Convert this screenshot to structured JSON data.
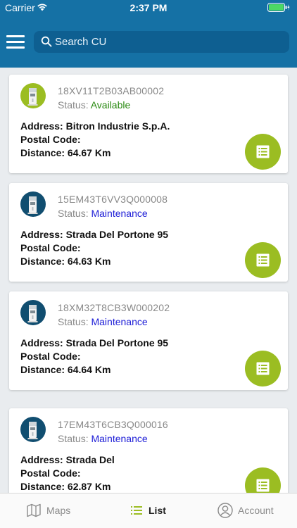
{
  "status_bar": {
    "carrier": "Carrier",
    "time": "2:37 PM"
  },
  "search": {
    "placeholder": "Search CU",
    "value": ""
  },
  "labels": {
    "status": "Status:",
    "address": "Address:",
    "postal_code": "Postal Code:",
    "distance": "Distance:"
  },
  "colors": {
    "header": "#1571a5",
    "available": "#2a8a12",
    "maintenance": "#1b1bd6",
    "fab": "#9bbd22"
  },
  "units": [
    {
      "id": "18XV11T2B03AB00002",
      "status": "Available",
      "status_kind": "available",
      "address": "Bitron Industrie S.p.A.",
      "postal_code": "",
      "distance": "64.67 Km"
    },
    {
      "id": "15EM43T6VV3Q000008",
      "status": "Maintenance",
      "status_kind": "maintenance",
      "address": "Strada Del Portone 95",
      "postal_code": "",
      "distance": "64.63 Km"
    },
    {
      "id": "18XM32T8CB3W000202",
      "status": "Maintenance",
      "status_kind": "maintenance",
      "address": "Strada Del Portone 95",
      "postal_code": "",
      "distance": "64.64 Km"
    },
    {
      "id": "17EM43T6CB3Q000016",
      "status": "Maintenance",
      "status_kind": "maintenance",
      "address": "Strada Del",
      "postal_code": "",
      "distance": "62.87 Km"
    }
  ],
  "tabs": [
    {
      "label": "Maps",
      "icon": "map-icon",
      "active": false
    },
    {
      "label": "List",
      "icon": "list-icon",
      "active": true
    },
    {
      "label": "Account",
      "icon": "account-icon",
      "active": false
    }
  ]
}
